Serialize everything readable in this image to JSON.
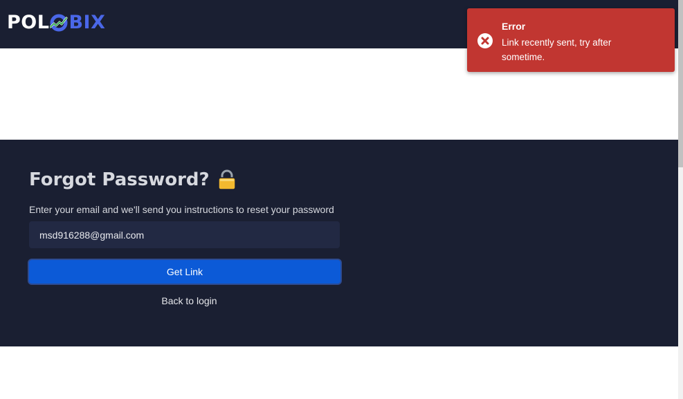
{
  "header": {
    "logo": {
      "part_a": "POL",
      "part_b": "BIX"
    }
  },
  "forgot": {
    "title": "Forgot Password?",
    "subtitle": "Enter your email and we'll send you instructions to reset your password",
    "email_value": "msd916288@gmail.com",
    "get_link_label": "Get Link",
    "back_label": "Back to login"
  },
  "toast": {
    "title": "Error",
    "message": "Link recently sent, try after sometime.",
    "icon": "error-circle-icon"
  },
  "colors": {
    "header_bg": "#1a1f32",
    "section_bg": "#1a1f32",
    "button_bg": "#0c5ad7",
    "toast_bg": "#c13631",
    "logo_accent": "#4a67e8"
  },
  "icons": {
    "lock": "lock-icon",
    "logo_o": "logo-o-mark-icon"
  }
}
